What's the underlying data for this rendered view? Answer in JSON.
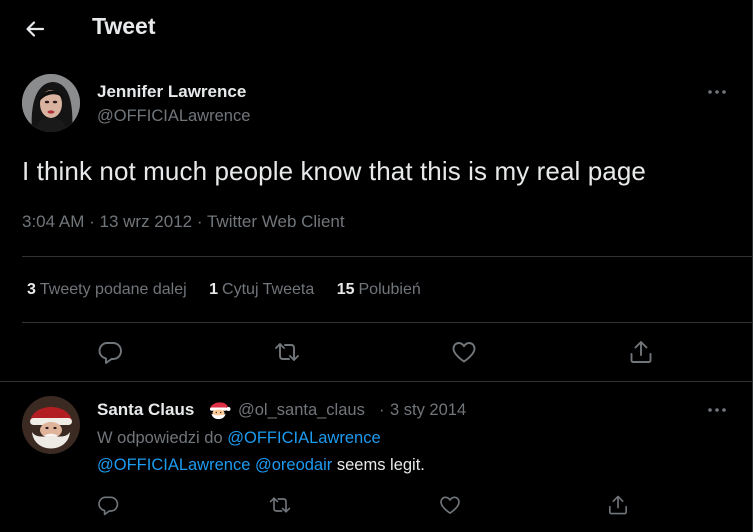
{
  "header": {
    "title": "Tweet"
  },
  "tweet": {
    "author": {
      "name": "Jennifer Lawrence",
      "handle": "@OFFICIALawrence"
    },
    "text": "I think not much people know that this is my real page",
    "time": "3:04 AM",
    "date": "13 wrz 2012",
    "source": "Twitter Web Client",
    "separator": "·",
    "stats": {
      "retweets": {
        "count": "3",
        "label": "Tweety podane dalej"
      },
      "quotes": {
        "count": "1",
        "label": "Cytuj Tweeta"
      },
      "likes": {
        "count": "15",
        "label": "Polubień"
      }
    }
  },
  "reply": {
    "author": {
      "name": "Santa Claus",
      "handle": "@ol_santa_claus"
    },
    "separator": "·",
    "date": "3 sty 2014",
    "replying_prefix": "W odpowiedzi do",
    "replying_to": "@OFFICIALawrence",
    "mentions": [
      "@OFFICIALawrence",
      "@oreodair"
    ],
    "text_rest": "seems legit."
  },
  "icons": {
    "back": "arrow-left-icon",
    "more": "more-dots-icon",
    "reply": "reply-bubble-icon",
    "retweet": "retweet-icon",
    "like": "heart-icon",
    "share": "share-upload-icon",
    "emoji": "santa-emoji"
  },
  "colors": {
    "background": "#000000",
    "text": "#e7e9ea",
    "muted": "#71767b",
    "link": "#1d9bf0",
    "border": "#2f3336"
  }
}
